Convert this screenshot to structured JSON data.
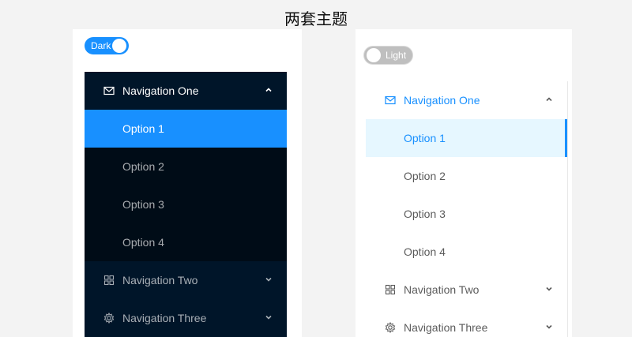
{
  "title": "两套主题",
  "colors": {
    "primary": "#1890ff",
    "dark_bg": "#001529",
    "dark_sub_bg": "#000c17",
    "light_selected_bg": "#e6f7ff"
  },
  "dark_theme": {
    "toggle_label": "Dark",
    "toggle_on": true,
    "menu": {
      "nav1": {
        "label": "Navigation One",
        "icon": "mail-icon",
        "expanded": true
      },
      "options": [
        "Option 1",
        "Option 2",
        "Option 3",
        "Option 4"
      ],
      "selected_option": "Option 1",
      "nav2": {
        "label": "Navigation Two",
        "icon": "appstore-icon"
      },
      "nav3": {
        "label": "Navigation Three",
        "icon": "gear-icon"
      }
    }
  },
  "light_theme": {
    "toggle_label": "Light",
    "toggle_on": false,
    "menu": {
      "nav1": {
        "label": "Navigation One",
        "icon": "mail-icon",
        "expanded": true
      },
      "options": [
        "Option 1",
        "Option 2",
        "Option 3",
        "Option 4"
      ],
      "selected_option": "Option 1",
      "nav2": {
        "label": "Navigation Two",
        "icon": "appstore-icon"
      },
      "nav3": {
        "label": "Navigation Three",
        "icon": "gear-icon"
      }
    }
  }
}
